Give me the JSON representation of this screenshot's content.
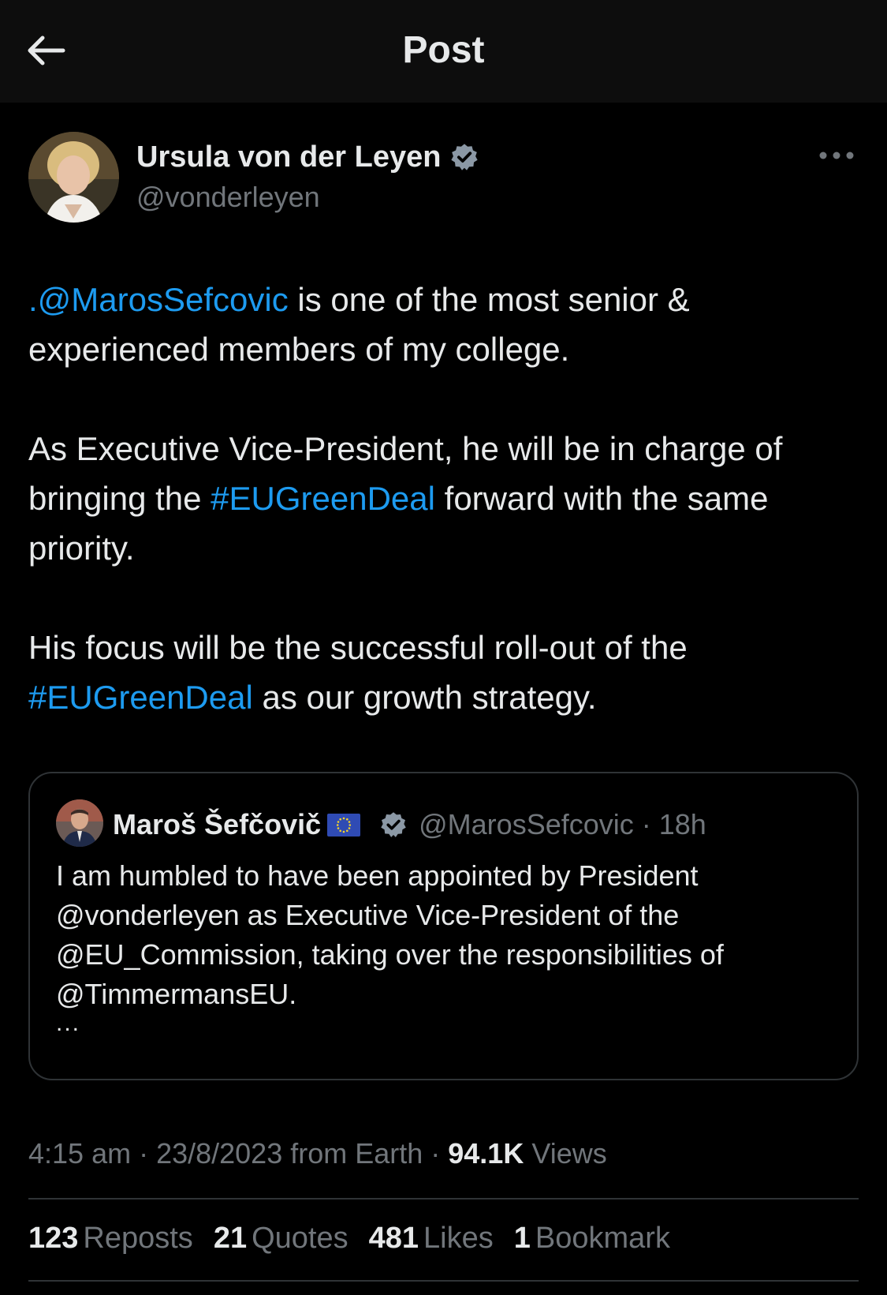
{
  "header": {
    "title": "Post",
    "back_icon": "arrow-left-icon"
  },
  "author": {
    "name": "Ursula von der Leyen",
    "handle": "@vonderleyen",
    "verified": true,
    "verified_color": "#71767b",
    "more_icon": "more-horizontal-icon"
  },
  "tweet": {
    "p1_mention": ".@MarosSefcovic",
    "p1_rest": " is one of the most senior & experienced members of my college.",
    "p2_start": "As Executive Vice-President, he will be in charge of bringing the ",
    "p2_hashtag": "#EUGreenDeal",
    "p2_end": " forward with the same priority.",
    "p3_start": "His focus will be the successful roll-out of the ",
    "p3_hashtag": "#EUGreenDeal",
    "p3_end": " as our growth strategy.",
    "link_color": "#1d9bf0"
  },
  "quote": {
    "name": "Maroš Šefčovič",
    "flag_icon": "eu-flag-icon",
    "verified": true,
    "handle_time": "@MarosSefcovic · 18h",
    "text": "I am humbled to have been appointed by President @vonderleyen as Executive Vice-President of the @EU_Commission, taking over the responsibilities of @TimmermansEU.",
    "ellipsis": "..."
  },
  "meta": {
    "time_date": "4:15 am · 23/8/2023 from Earth · ",
    "views_count": "94.1K",
    "views_label": " Views"
  },
  "stats": [
    {
      "count": "123",
      "label": "Reposts"
    },
    {
      "count": "21",
      "label": "Quotes"
    },
    {
      "count": "481",
      "label": "Likes"
    },
    {
      "count": "1",
      "label": "Bookmark"
    }
  ]
}
